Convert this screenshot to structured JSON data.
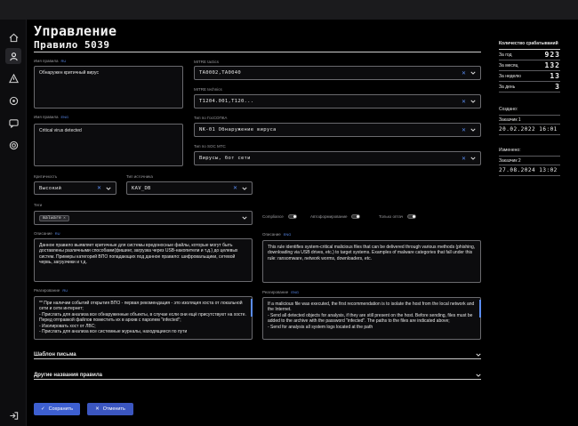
{
  "header": {
    "section_title": "Управление",
    "rule_title": "Правило 5039"
  },
  "sidebar": {
    "icons": [
      "home-icon",
      "user-shield-icon",
      "alert-icon",
      "radar-icon",
      "chat-icon",
      "support-icon",
      "logout-icon"
    ],
    "active_index": 1
  },
  "form": {
    "name_ru": {
      "label": "Имя правила",
      "lang": "RU",
      "value": "Обнаружен критичный вирус"
    },
    "name_en": {
      "label": "Имя правила",
      "lang": "ENG",
      "value": "Critical virus detected"
    },
    "mitre_tactics": {
      "label": "MITRE tactics",
      "value": "TA0002,TA0040"
    },
    "mitre_technics": {
      "label": "MITRE technics",
      "value": "T1204.001,T120..."
    },
    "gossopka_type": {
      "label": "Тип по ГосСОПКА",
      "value": "NK-01 Обнаружение вируса"
    },
    "soc_mtc_type": {
      "label": "Тип по SOC MTC",
      "value": "Вирусы, бот сети"
    },
    "criticality": {
      "label": "Критичность",
      "value": "Высокий"
    },
    "source_type": {
      "label": "Тип источника",
      "value": "KAV_DB"
    },
    "tags": {
      "label": "Теги",
      "items": [
        "malware"
      ]
    },
    "toggles": [
      {
        "label": "Compliance"
      },
      {
        "label": "Автоформирование"
      },
      {
        "label": "Только оптач"
      }
    ],
    "description_ru": {
      "label": "Описание",
      "lang": "RU",
      "value": "Данное правило выявляет критичные для системы вредоносные файлы, которые могут быть доставлены различными способами(фишинг, загрузка через USB-накопители и т.д.) до целевых систем. Примеры категорий ВПО попадающих под данное правило: шифровальщики, сетевой червь, загрузчики и т.д."
    },
    "description_en": {
      "label": "Описание",
      "lang": "ENG",
      "value": "This rule identifies system-critical malicious files that can be delivered through various methods (phishing, downloading via USB drives, etc.) to target systems. Examples of malware categories that fall under this rule: ransomware, network worms, downloaders, etc."
    },
    "response_ru": {
      "label": "Реагирование",
      "lang": "RU",
      "value": "** При наличии событий открытия ВПО - первая рекомендация - это изоляция хоста от локальной сети и сети интернет;\n- Прислать для анализа все обнаруженные объекты, в случае если они ещё присутствуют на хосте. Перед отправкой файлов поместить их в архив с паролем \"infected\";\n- Изолировать хост от ЛВС;\n- Прислать для анализа все системные журналы, находящиеся по пути"
    },
    "response_en": {
      "label": "Реагирование",
      "lang": "ENG",
      "value": "If a malicious file was executed, the first recommendation is to isolate the host from the local network and the Internet.\n- Send all detected objects for analysis, if they are still present on the host. Before sending, files must be added to the archive with the password \"infected\". The paths to the files are indicated above;\n- Send for analysis all system logs located at the path"
    }
  },
  "sections": [
    {
      "title": "Шаблон письма"
    },
    {
      "title": "Другие названия правила"
    }
  ],
  "buttons": {
    "save": "Сохранить",
    "cancel": "Отменить"
  },
  "stats": {
    "header": "Количество срабатываний",
    "rows": [
      {
        "label": "За год",
        "value": "923"
      },
      {
        "label": "За месяц",
        "value": "132"
      },
      {
        "label": "За неделю",
        "value": "13"
      },
      {
        "label": "За день",
        "value": "3"
      }
    ],
    "created": {
      "label": "Создано:",
      "by": "Заказчик 1",
      "date": "20.02.2022 16:01"
    },
    "modified": {
      "label": "Изменено:",
      "by": "Заказчик 2",
      "date": "27.08.2024 13:02"
    }
  },
  "colors": {
    "accent": "#3d5fd0",
    "lang_tag": "#5a8cf0",
    "background": "#000000"
  }
}
